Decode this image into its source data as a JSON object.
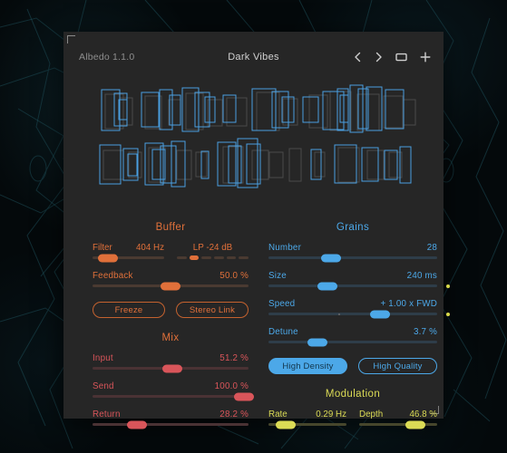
{
  "window": {
    "app_name": "Albedo 1.1.0",
    "preset_name": "Dark Vibes",
    "controls": [
      {
        "name": "prev-preset",
        "icon": "chevron-left-icon"
      },
      {
        "name": "next-preset",
        "icon": "chevron-right-icon"
      },
      {
        "name": "preset-browser",
        "icon": "rectangle-icon"
      },
      {
        "name": "add-preset",
        "icon": "plus-icon"
      }
    ]
  },
  "colors": {
    "orange": "#e0703a",
    "red": "#d9555a",
    "blue": "#4ca8e8",
    "yellow": "#dbdb55",
    "panel_bg": "#262626",
    "track": "#3a3a3a"
  },
  "buffer": {
    "title": "Buffer",
    "filter": {
      "label": "Filter",
      "value": "404 Hz",
      "pos": 22
    },
    "slope": {
      "label": "LP -24 dB",
      "segments": 6,
      "active_index": 1
    },
    "feedback": {
      "label": "Feedback",
      "value": "50.0 %",
      "pos": 50
    },
    "freeze": {
      "label": "Freeze",
      "active": false
    },
    "stereo_link": {
      "label": "Stereo Link",
      "active": false
    }
  },
  "mix": {
    "title": "Mix",
    "rows": [
      {
        "label": "Input",
        "value": "51.2 %",
        "pos": 51.2
      },
      {
        "label": "Send",
        "value": "100.0 %",
        "pos": 100
      },
      {
        "label": "Return",
        "value": "28.2 %",
        "pos": 28.2
      }
    ]
  },
  "grains": {
    "title": "Grains",
    "rows": [
      {
        "label": "Number",
        "value": "28",
        "pos": 37,
        "mod": false
      },
      {
        "label": "Size",
        "value": "240 ms",
        "pos": 35,
        "mod": true
      },
      {
        "label": "Speed",
        "value": "+ 1.00 x FWD",
        "pos": 66,
        "mod": true,
        "center_tick": 42
      },
      {
        "label": "Detune",
        "value": "3.7 %",
        "pos": 29,
        "mod": false
      }
    ],
    "high_density": {
      "label": "High Density",
      "active": true
    },
    "high_quality": {
      "label": "High Quality",
      "active": false
    }
  },
  "modulation": {
    "title": "Modulation",
    "rate": {
      "label": "Rate",
      "value": "0.29 Hz",
      "pos": 22
    },
    "depth": {
      "label": "Depth",
      "value": "46.8 %",
      "pos": 72
    }
  },
  "visualizer": {
    "name": "grain-visualizer",
    "rows": 2,
    "active_color": "#4a9fe0",
    "inactive_color": "#4a4a4a"
  }
}
